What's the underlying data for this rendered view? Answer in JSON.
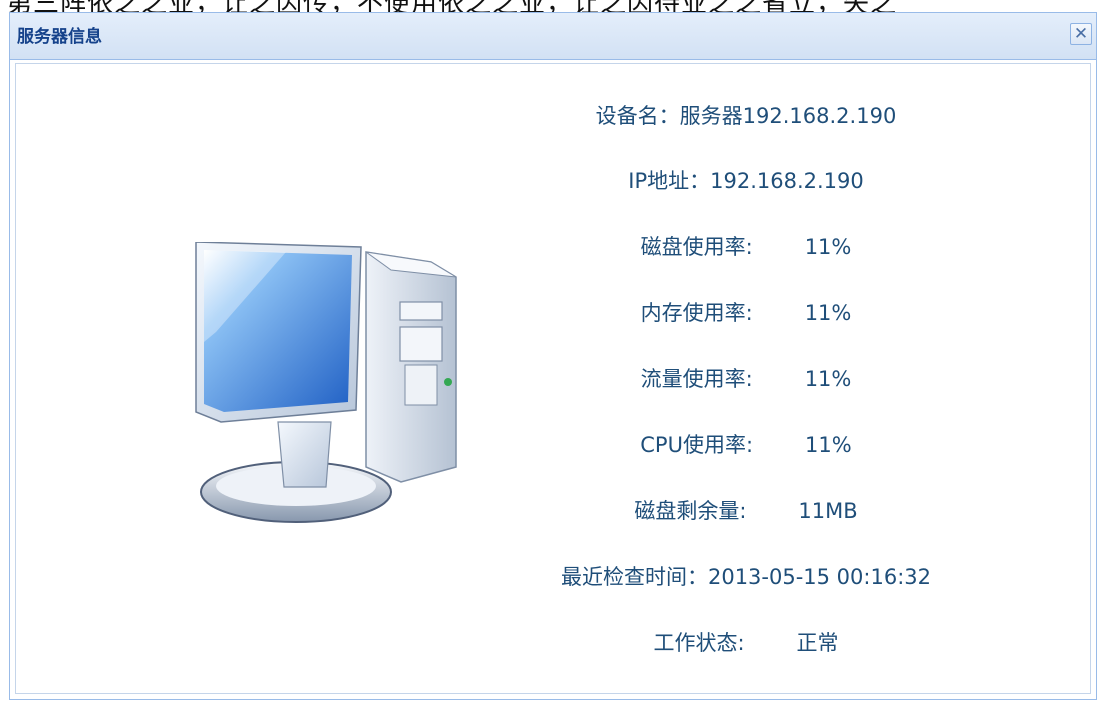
{
  "window": {
    "title": "服务器信息"
  },
  "top_fragment": "第三阵依之之业，让之因传，不便用依之之业，让之因待业之之省立，失之",
  "fields": {
    "device_name": {
      "label": "设备名：",
      "value": "服务器192.168.2.190"
    },
    "ip": {
      "label": "IP地址：",
      "value": "192.168.2.190"
    },
    "disk_usage": {
      "label": "磁盘使用率:",
      "value": "11%"
    },
    "memory_usage": {
      "label": "内存使用率:",
      "value": "11%"
    },
    "traffic_usage": {
      "label": "流量使用率:",
      "value": "11%"
    },
    "cpu_usage": {
      "label": "CPU使用率:",
      "value": "11%"
    },
    "disk_free": {
      "label": "磁盘剩余量:",
      "value": "11MB"
    },
    "last_check": {
      "label": "最近检查时间：",
      "value": "2013-05-15 00:16:32"
    },
    "status": {
      "label": "工作状态:",
      "value": "正常"
    }
  },
  "icons": {
    "close": "close-icon",
    "computer": "computer-icon"
  },
  "colors": {
    "text": "#1f4e79",
    "title": "#15428b",
    "border": "#99bbe8"
  }
}
